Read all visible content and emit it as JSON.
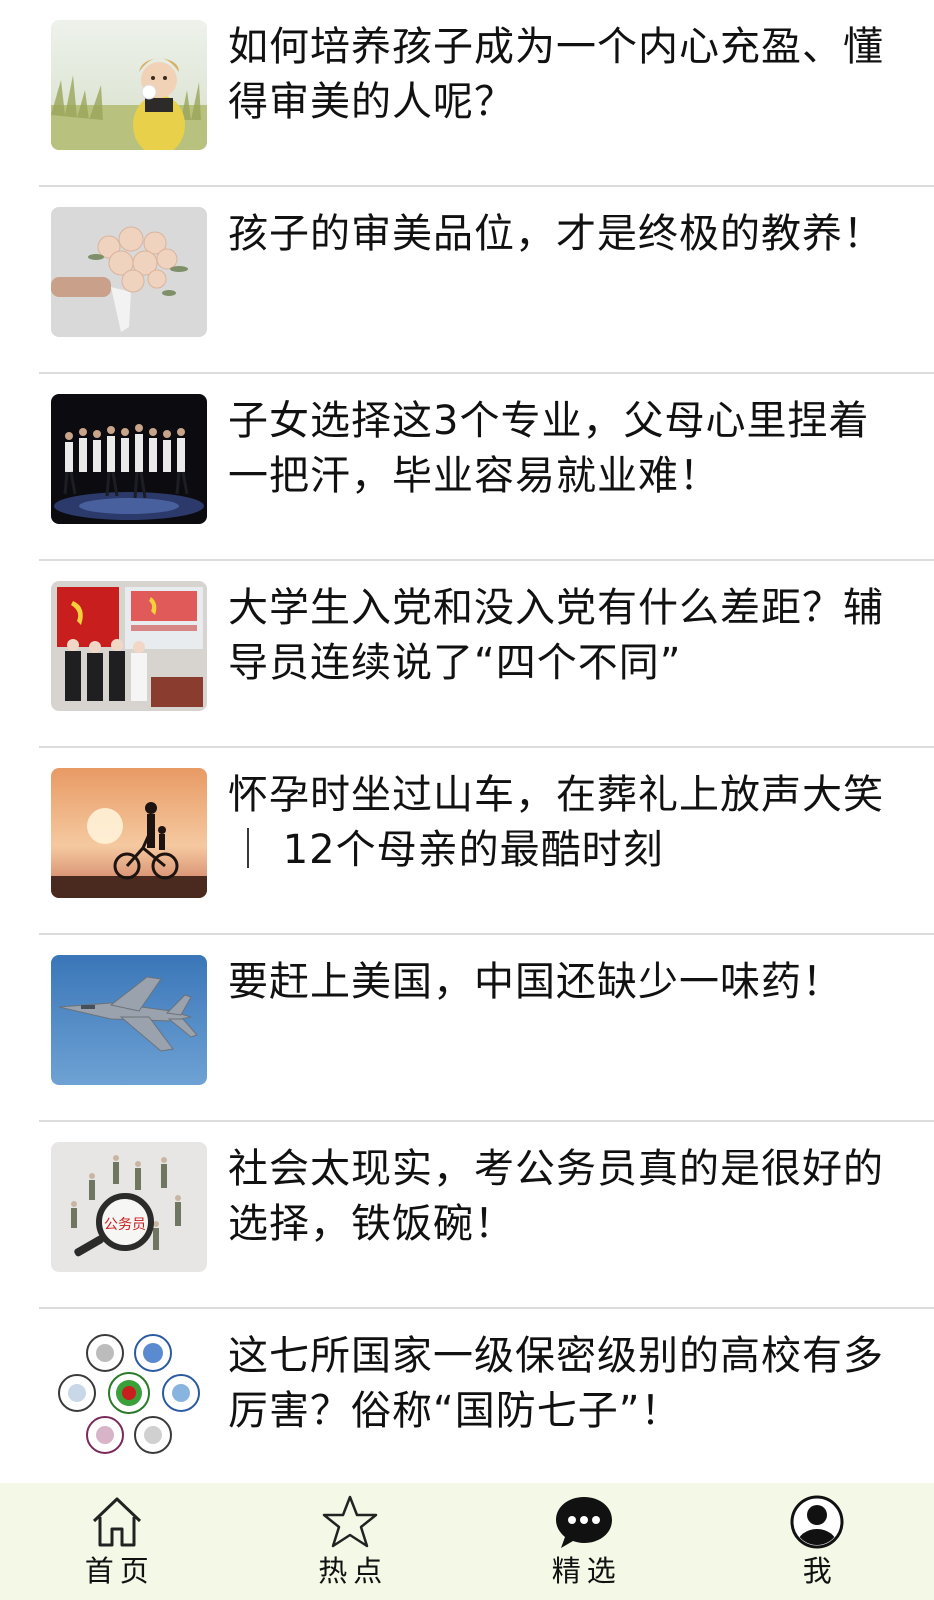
{
  "articles": [
    {
      "title": "如何培养孩子成为一个内心充盈、懂得审美的人呢？",
      "thumbnail": "girl-with-dandelion-photo"
    },
    {
      "title": "孩子的审美品位，才是终极的教养！",
      "thumbnail": "rose-bouquet-photo"
    },
    {
      "title": "子女选择这3个专业，父母心里捏着一把汗，毕业容易就业难！",
      "thumbnail": "dance-group-stage-photo"
    },
    {
      "title": "大学生入党和没入党有什么差距？辅导员连续说了“四个不同”",
      "thumbnail": "party-meeting-photo"
    },
    {
      "title": "怀孕时坐过山车，在葬礼上放声大笑 ｜ 12个母亲的最酷时刻",
      "thumbnail": "sunset-bicycle-photo"
    },
    {
      "title": "要赶上美国，中国还缺少一味药！",
      "thumbnail": "fighter-jet-photo"
    },
    {
      "title": "社会太现实，考公务员真的是很好的选择，铁饭碗！",
      "thumbnail": "civil-servant-magnifier-photo",
      "thumbnail_text": "公务员"
    },
    {
      "title": "这七所国家一级保密级别的高校有多厉害？俗称“国防七子”！",
      "thumbnail": "university-seals-photo"
    }
  ],
  "tabbar": {
    "tabs": [
      {
        "label": "首页",
        "icon": "home-icon"
      },
      {
        "label": "热点",
        "icon": "star-icon"
      },
      {
        "label": "精选",
        "icon": "chat-bubble-icon"
      },
      {
        "label": "我",
        "icon": "user-icon"
      }
    ],
    "background": "#f3f9e6"
  }
}
